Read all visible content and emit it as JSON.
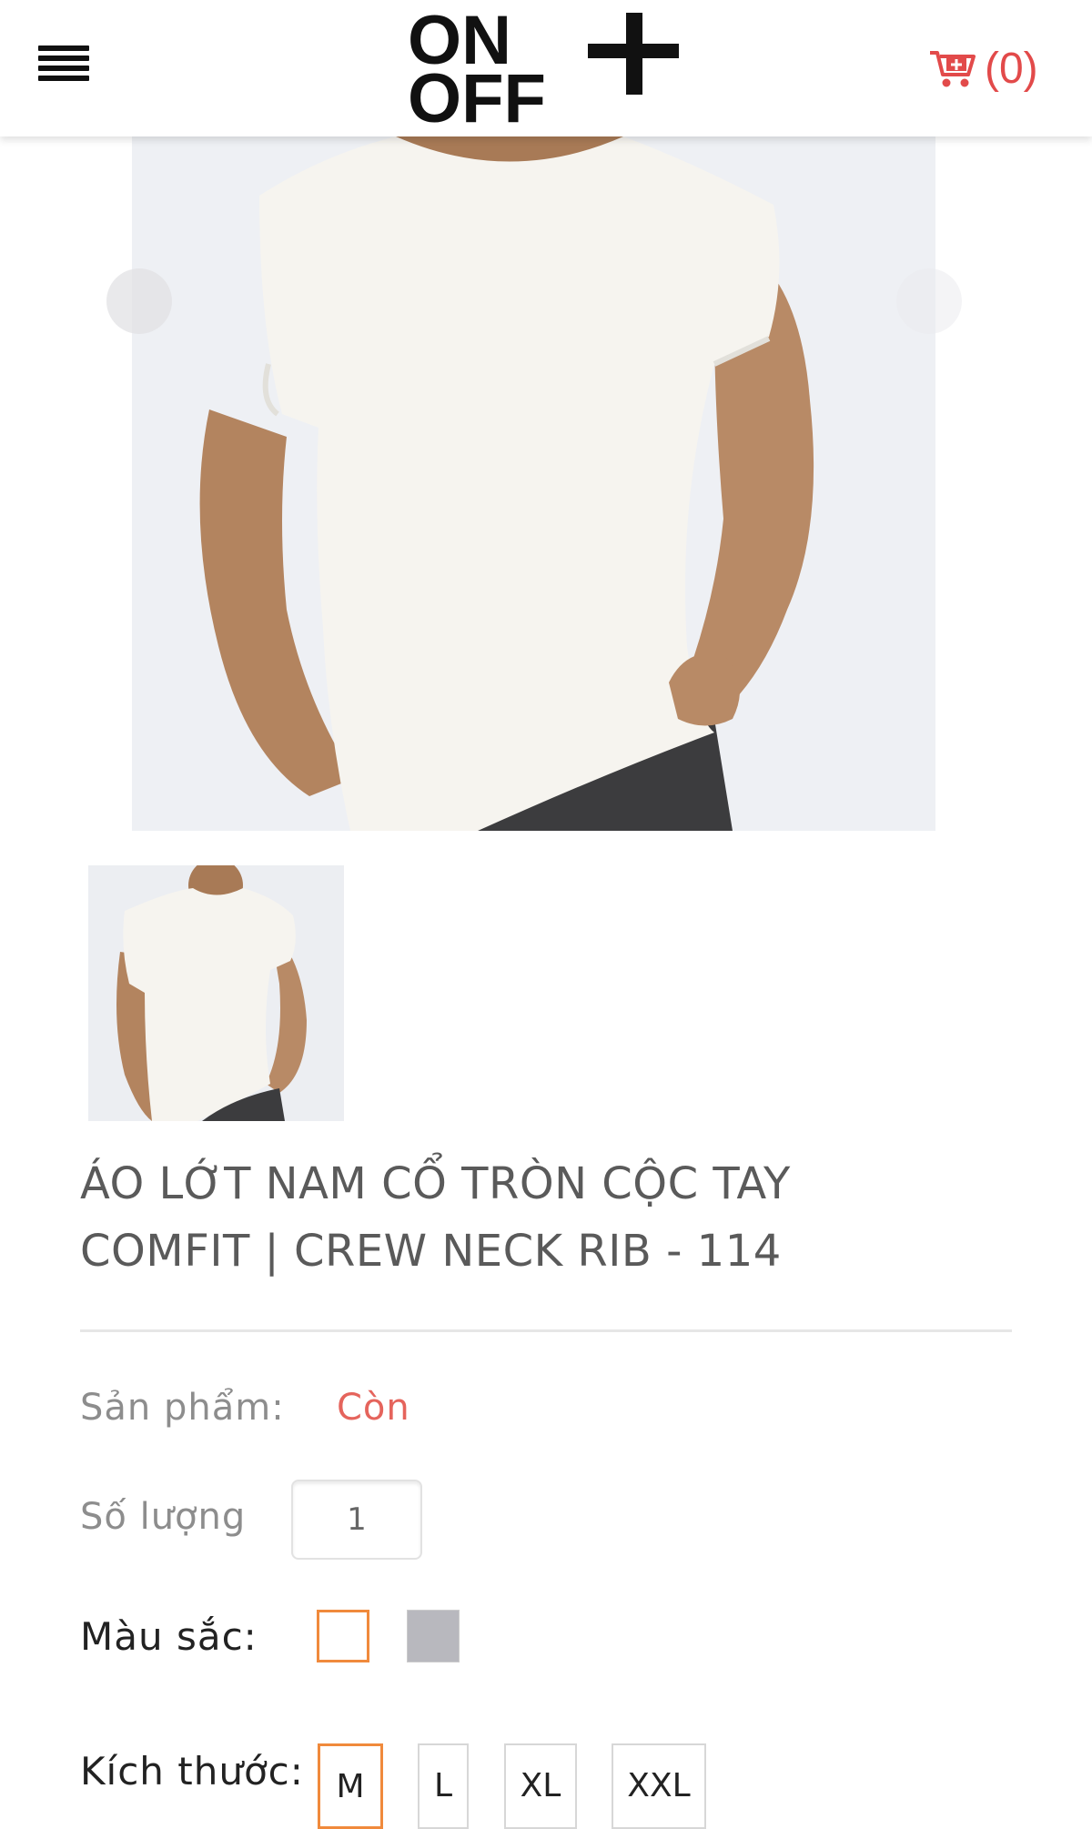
{
  "header": {
    "cart_count": "(0)",
    "brand_color": "#e24a4a"
  },
  "logo": {
    "text_top": "ON",
    "text_bottom": "OFF",
    "plus": "+"
  },
  "product": {
    "title_line1": "ÁO LỚT NAM CỔ TRÒN CỘC TAY",
    "title_line2": "COMFIT | CREW NECK RIB - 114",
    "availability_label": "Sản phẩm:",
    "availability_value": "Còn",
    "quantity_label": "Số lượng",
    "quantity_value": "1",
    "color_label": "Màu sắc:",
    "colors": [
      {
        "name": "white",
        "hex": "#ffffff",
        "selected": true
      },
      {
        "name": "gray",
        "hex": "#b8b8be",
        "selected": false
      }
    ],
    "size_label": "Kích thước:",
    "sizes": [
      "M",
      "L",
      "XL",
      "XXL"
    ],
    "selected_size": "M"
  },
  "colors": {
    "accent_orange": "#f08a3c",
    "status_red": "#e5645c"
  }
}
